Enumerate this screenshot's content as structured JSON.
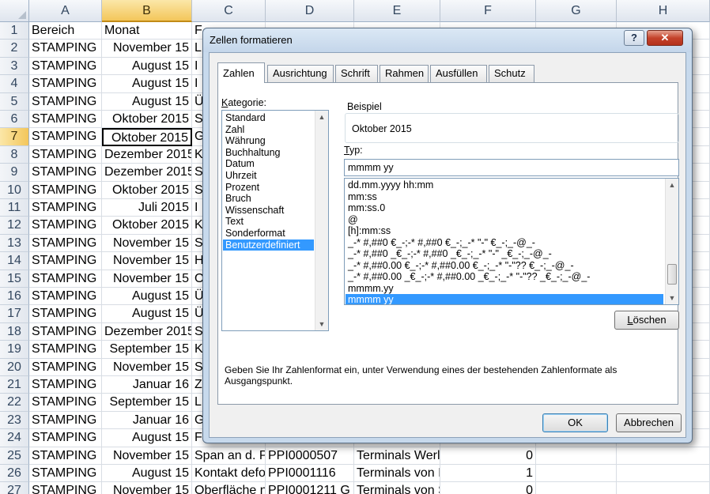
{
  "sheet": {
    "columns": [
      "A",
      "B",
      "C",
      "D",
      "E",
      "F",
      "G",
      "H"
    ],
    "selected_column": "B",
    "selected_row": 7,
    "rows": [
      {
        "n": "1",
        "a": "Bereich",
        "b": "Monat",
        "c": "F",
        "d": "",
        "e": "",
        "f": "",
        "header": true
      },
      {
        "n": "2",
        "a": "STAMPING",
        "b": "November 15",
        "c": "L",
        "d": "",
        "e": "",
        "f": ""
      },
      {
        "n": "3",
        "a": "STAMPING",
        "b": "August 15",
        "c": "I",
        "d": "",
        "e": "",
        "f": ""
      },
      {
        "n": "4",
        "a": "STAMPING",
        "b": "August 15",
        "c": "I",
        "d": "",
        "e": "",
        "f": ""
      },
      {
        "n": "5",
        "a": "STAMPING",
        "b": "August 15",
        "c": "Ü",
        "d": "",
        "e": "",
        "f": ""
      },
      {
        "n": "6",
        "a": "STAMPING",
        "b": "Oktober 2015",
        "c": "S",
        "d": "",
        "e": "",
        "f": ""
      },
      {
        "n": "7",
        "a": "STAMPING",
        "b": "Oktober 2015",
        "c": "G",
        "d": "",
        "e": "",
        "f": ""
      },
      {
        "n": "8",
        "a": "STAMPING",
        "b": "Dezember 2015",
        "c": "K",
        "d": "",
        "e": "",
        "f": ""
      },
      {
        "n": "9",
        "a": "STAMPING",
        "b": "Dezember 2015",
        "c": "S",
        "d": "",
        "e": "",
        "f": ""
      },
      {
        "n": "10",
        "a": "STAMPING",
        "b": "Oktober 2015",
        "c": "S",
        "d": "",
        "e": "",
        "f": ""
      },
      {
        "n": "11",
        "a": "STAMPING",
        "b": "Juli 2015",
        "c": "I",
        "d": "",
        "e": "",
        "f": ""
      },
      {
        "n": "12",
        "a": "STAMPING",
        "b": "Oktober 2015",
        "c": "K",
        "d": "",
        "e": "",
        "f": ""
      },
      {
        "n": "13",
        "a": "STAMPING",
        "b": "November 15",
        "c": "S",
        "d": "",
        "e": "",
        "f": ""
      },
      {
        "n": "14",
        "a": "STAMPING",
        "b": "November 15",
        "c": "H",
        "d": "",
        "e": "",
        "f": ""
      },
      {
        "n": "15",
        "a": "STAMPING",
        "b": "November 15",
        "c": "O",
        "d": "",
        "e": "",
        "f": ""
      },
      {
        "n": "16",
        "a": "STAMPING",
        "b": "August 15",
        "c": "Ü",
        "d": "",
        "e": "",
        "f": ""
      },
      {
        "n": "17",
        "a": "STAMPING",
        "b": "August 15",
        "c": "Ü",
        "d": "",
        "e": "",
        "f": ""
      },
      {
        "n": "18",
        "a": "STAMPING",
        "b": "Dezember 2015",
        "c": "S",
        "d": "",
        "e": "",
        "f": ""
      },
      {
        "n": "19",
        "a": "STAMPING",
        "b": "September 15",
        "c": "K",
        "d": "",
        "e": "",
        "f": ""
      },
      {
        "n": "20",
        "a": "STAMPING",
        "b": "November 15",
        "c": "S",
        "d": "",
        "e": "",
        "f": ""
      },
      {
        "n": "21",
        "a": "STAMPING",
        "b": "Januar 16",
        "c": "Z",
        "d": "",
        "e": "",
        "f": ""
      },
      {
        "n": "22",
        "a": "STAMPING",
        "b": "September 15",
        "c": "L",
        "d": "",
        "e": "",
        "f": ""
      },
      {
        "n": "23",
        "a": "STAMPING",
        "b": "Januar 16",
        "c": "G",
        "d": "",
        "e": "",
        "f": ""
      },
      {
        "n": "24",
        "a": "STAMPING",
        "b": "August 15",
        "c": "F",
        "d": "",
        "e": "",
        "f": ""
      },
      {
        "n": "25",
        "a": "STAMPING",
        "b": "November 15",
        "c": "Span an d. Pr",
        "d": "PPI0000507",
        "e": "Terminals Werl",
        "f": "0"
      },
      {
        "n": "26",
        "a": "STAMPING",
        "b": "August 15",
        "c": "Kontakt defo",
        "d": "PPI0001116",
        "e": "Terminals von I",
        "f": "1"
      },
      {
        "n": "27",
        "a": "STAMPING",
        "b": "November 15",
        "c": "Oberfläche n",
        "d": "PPI0001211 G",
        "e": "Terminals von S",
        "f": "0"
      }
    ]
  },
  "dialog": {
    "title": "Zellen formatieren",
    "help_label": "?",
    "close_label": "✕",
    "tabs": [
      "Zahlen",
      "Ausrichtung",
      "Schrift",
      "Rahmen",
      "Ausfüllen",
      "Schutz"
    ],
    "active_tab": "Zahlen",
    "kategorie_label_u": "K",
    "kategorie_label_rest": "ategorie:",
    "categories": [
      "Standard",
      "Zahl",
      "Währung",
      "Buchhaltung",
      "Datum",
      "Uhrzeit",
      "Prozent",
      "Bruch",
      "Wissenschaft",
      "Text",
      "Sonderformat",
      "Benutzerdefiniert"
    ],
    "selected_category": "Benutzerdefiniert",
    "beispiel_label": "Beispiel",
    "beispiel_value": "Oktober 2015",
    "typ_label_u": "T",
    "typ_label_rest": "yp:",
    "typ_value": "mmmm yy",
    "formats": [
      "dd.mm.yyyy hh:mm",
      "mm:ss",
      "mm:ss.0",
      "@",
      "[h]:mm:ss",
      "_-* #,##0 €_-;-* #,##0 €_-;_-* \"-\" €_-;_-@_-",
      "_-* #,##0 _€_-;-* #,##0 _€_-;_-* \"-\" _€_-;_-@_-",
      "_-* #,##0.00 €_-;-* #,##0.00 €_-;_-* \"-\"?? €_-;_-@_-",
      "_-* #,##0.00 _€_-;-* #,##0.00 _€_-;_-* \"-\"?? _€_-;_-@_-",
      "mmmm.yy",
      "mmmm yy"
    ],
    "selected_format": "mmmm yy",
    "delete_label_u": "L",
    "delete_label_rest": "öschen",
    "hint": "Geben Sie Ihr Zahlenformat ein, unter Verwendung eines der bestehenden Zahlenformate als Ausgangspunkt.",
    "ok_label": "OK",
    "cancel_label": "Abbrechen"
  }
}
